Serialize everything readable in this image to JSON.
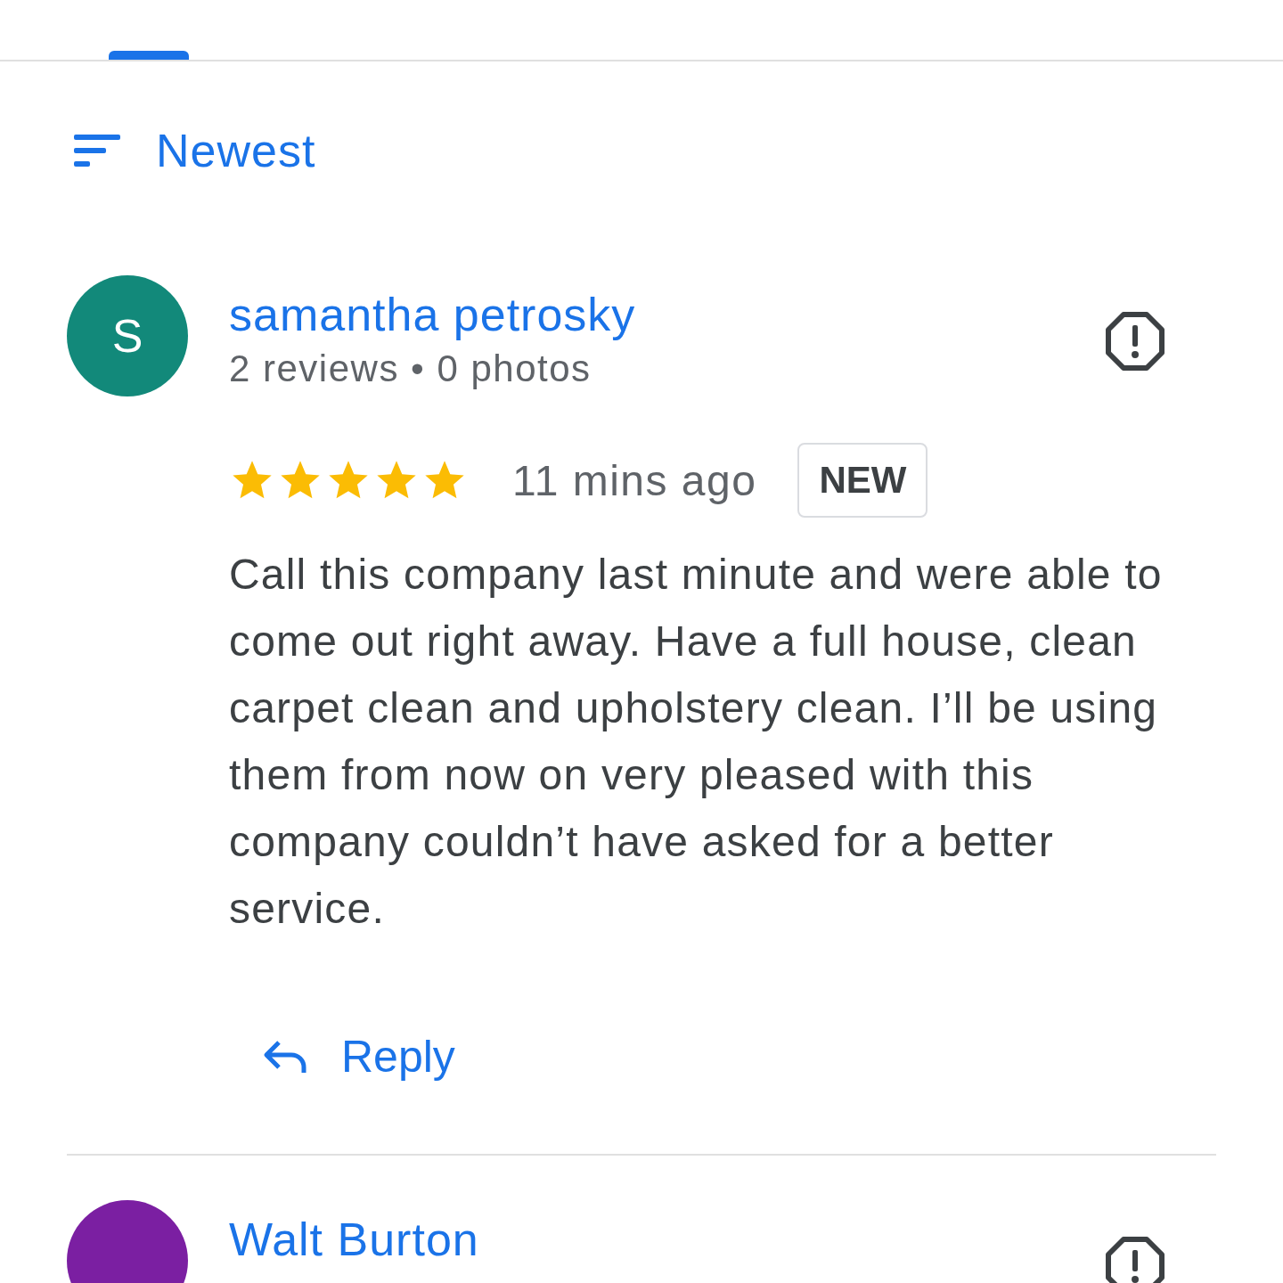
{
  "sort": {
    "label": "Newest"
  },
  "reviews": [
    {
      "initial": "S",
      "color": "#12897a",
      "name": "samantha petrosky",
      "meta": "2 reviews • 0 photos",
      "stars": 5,
      "time": "11 mins ago",
      "badge": "NEW",
      "text": "Call this company last minute and were able to come out right away. Have a full house, clean carpet clean and upholstery clean. I’ll be using them from now on very pleased with this company couldn’t have asked for a better service.",
      "reply": "Reply"
    },
    {
      "color": "#7b1fa2",
      "name": "Walt Burton"
    }
  ]
}
